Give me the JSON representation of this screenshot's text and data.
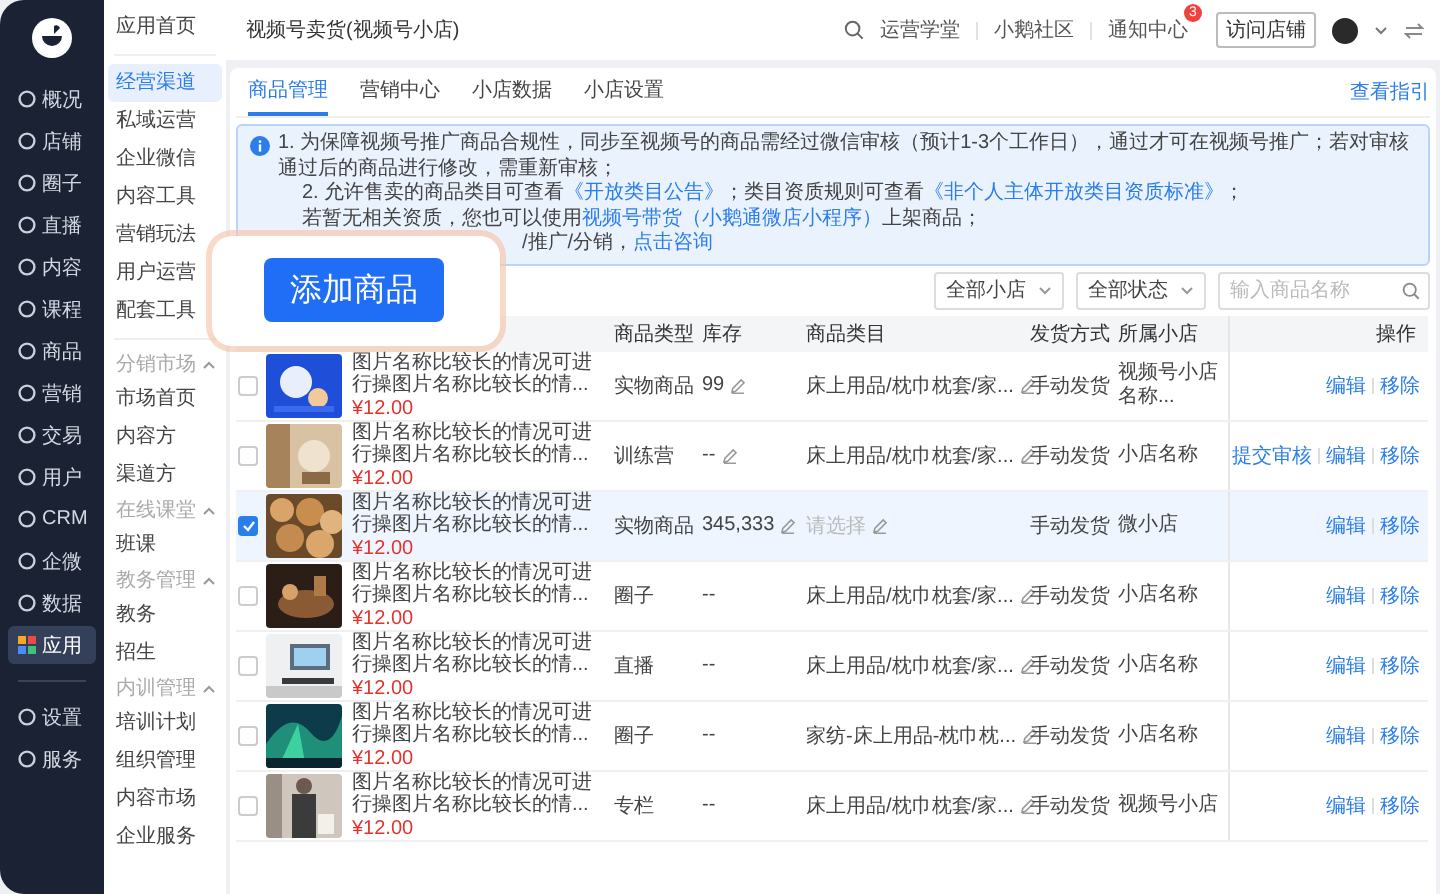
{
  "nav": {
    "main": [
      {
        "label": "概况",
        "selected": false
      },
      {
        "label": "店铺",
        "selected": false
      },
      {
        "label": "圈子",
        "selected": false
      },
      {
        "label": "直播",
        "selected": false
      },
      {
        "label": "内容",
        "selected": false
      },
      {
        "label": "课程",
        "selected": false
      },
      {
        "label": "商品",
        "selected": false
      },
      {
        "label": "营销",
        "selected": false
      },
      {
        "label": "交易",
        "selected": false
      },
      {
        "label": "用户",
        "selected": false
      },
      {
        "label": "CRM",
        "selected": false
      },
      {
        "label": "企微",
        "selected": false
      },
      {
        "label": "数据",
        "selected": false
      },
      {
        "label": "应用",
        "selected": true
      }
    ],
    "bottom": [
      {
        "label": "设置",
        "selected": false
      },
      {
        "label": "服务",
        "selected": false
      }
    ]
  },
  "subnav": {
    "home": {
      "label": "应用首页",
      "selected": false
    },
    "items": [
      {
        "label": "经营渠道",
        "selected": true
      },
      {
        "label": "私域运营",
        "selected": false
      },
      {
        "label": "企业微信",
        "selected": false
      },
      {
        "label": "内容工具",
        "selected": false
      },
      {
        "label": "营销玩法",
        "selected": false
      },
      {
        "label": "用户运营",
        "selected": false
      },
      {
        "label": "配套工具",
        "selected": false
      }
    ],
    "groups": [
      {
        "label": "分销市场",
        "expanded": true,
        "children": [
          {
            "label": "市场首页",
            "selected": false
          },
          {
            "label": "内容方",
            "selected": false
          },
          {
            "label": "渠道方",
            "selected": false
          }
        ]
      },
      {
        "label": "在线课堂",
        "expanded": true,
        "children": [
          {
            "label": "班课",
            "selected": false
          }
        ]
      },
      {
        "label": "教务管理",
        "expanded": true,
        "children": [
          {
            "label": "教务",
            "selected": false
          },
          {
            "label": "招生",
            "selected": false
          }
        ]
      },
      {
        "label": "内训管理",
        "expanded": true,
        "children": [
          {
            "label": "培训计划",
            "selected": false
          },
          {
            "label": "组织管理",
            "selected": false
          },
          {
            "label": "内容市场",
            "selected": false
          },
          {
            "label": "企业服务",
            "selected": false
          }
        ]
      }
    ]
  },
  "topbar": {
    "title": "视频号卖货(视频号小店)",
    "links": [
      {
        "label": "运营学堂"
      },
      {
        "label": "小鹅社区"
      },
      {
        "label": "通知中心",
        "badge": "3"
      }
    ],
    "button": "访问店铺"
  },
  "tabs": [
    {
      "label": "商品管理",
      "selected": true
    },
    {
      "label": "营销中心",
      "selected": false
    },
    {
      "label": "小店数据",
      "selected": false
    },
    {
      "label": "小店设置",
      "selected": false
    }
  ],
  "guide_link": "查看指引",
  "notice": [
    {
      "partly_hidden": false,
      "segments": [
        {
          "kind": "text",
          "text": "1. 为保障视频号推广商品合规性，同步至视频号的商品需经过微信审核（预计1-3个工作日），通过才可在视频号推广；若对审核通过后的商品进行修改，需重新审核；"
        }
      ]
    },
    {
      "partly_hidden": false,
      "segments": [
        {
          "kind": "text",
          "text": "2. 允许售卖的商品类目可查看"
        },
        {
          "kind": "link",
          "text": "《开放类目公告》"
        },
        {
          "kind": "text",
          "text": "；类目资质规则可查看"
        },
        {
          "kind": "link",
          "text": "《非个人主体开放类目资质标准》"
        },
        {
          "kind": "text",
          "text": "；"
        }
      ]
    },
    {
      "partly_hidden": false,
      "segments": [
        {
          "kind": "text",
          "text": "若暂无相关资质，您也可以使用"
        },
        {
          "kind": "link",
          "text": "视频号带货（小鹅通微店小程序）"
        },
        {
          "kind": "text",
          "text": "上架商品；"
        }
      ]
    },
    {
      "partly_hidden": true,
      "segments": [
        {
          "kind": "text",
          "text": "/推广/分销，"
        },
        {
          "kind": "link",
          "text": "点击咨询"
        }
      ]
    }
  ],
  "popup": {
    "button": "添加商品"
  },
  "filters": {
    "dropdowns": [
      "全部小店",
      "全部状态"
    ],
    "search": {
      "placeholder": "输入商品名称"
    }
  },
  "table": {
    "columns": [
      "商品类型",
      "库存",
      "商品类目",
      "发货方式",
      "所属小店",
      "操作"
    ],
    "rows": [
      {
        "selected": false,
        "name": "图片名称比较长的情况可进行操图片名称比较长的情...",
        "price": "¥12.00",
        "type": "实物商品",
        "stock": "99",
        "stock_editable": true,
        "category": "床上用品/枕巾枕套/家...",
        "category_empty": false,
        "shipping": "手动发货",
        "shop": "视频号小店名称...",
        "actions": [
          "编辑",
          "移除"
        ]
      },
      {
        "selected": false,
        "name": "图片名称比较长的情况可进行操图片名称比较长的情...",
        "price": "¥12.00",
        "type": "训练营",
        "stock": "--",
        "stock_editable": true,
        "category": "床上用品/枕巾枕套/家...",
        "category_empty": false,
        "shipping": "手动发货",
        "shop": "小店名称",
        "actions": [
          "提交审核",
          "编辑",
          "移除"
        ]
      },
      {
        "selected": true,
        "name": "图片名称比较长的情况可进行操图片名称比较长的情...",
        "price": "¥12.00",
        "type": "实物商品",
        "stock": "345,333",
        "stock_editable": true,
        "category": "请选择",
        "category_empty": true,
        "shipping": "手动发货",
        "shop": "微小店",
        "actions": [
          "编辑",
          "移除"
        ]
      },
      {
        "selected": false,
        "name": "图片名称比较长的情况可进行操图片名称比较长的情...",
        "price": "¥12.00",
        "type": "圈子",
        "stock": "--",
        "stock_editable": false,
        "category": "床上用品/枕巾枕套/家...",
        "category_empty": false,
        "shipping": "手动发货",
        "shop": "小店名称",
        "actions": [
          "编辑",
          "移除"
        ]
      },
      {
        "selected": false,
        "name": "图片名称比较长的情况可进行操图片名称比较长的情...",
        "price": "¥12.00",
        "type": "直播",
        "stock": "--",
        "stock_editable": false,
        "category": "床上用品/枕巾枕套/家...",
        "category_empty": false,
        "shipping": "手动发货",
        "shop": "小店名称",
        "actions": [
          "编辑",
          "移除"
        ]
      },
      {
        "selected": false,
        "name": "图片名称比较长的情况可进行操图片名称比较长的情...",
        "price": "¥12.00",
        "type": "圈子",
        "stock": "--",
        "stock_editable": false,
        "category": "家纺-床上用品-枕巾枕...",
        "category_empty": false,
        "shipping": "手动发货",
        "shop": "小店名称",
        "actions": [
          "编辑",
          "移除"
        ]
      },
      {
        "selected": false,
        "name": "图片名称比较长的情况可进行操图片名称比较长的情...",
        "price": "¥12.00",
        "type": "专栏",
        "stock": "--",
        "stock_editable": false,
        "category": "床上用品/枕巾枕套/家...",
        "category_empty": false,
        "shipping": "手动发货",
        "shop": "视频号小店",
        "actions": [
          "编辑",
          "移除"
        ]
      }
    ]
  }
}
